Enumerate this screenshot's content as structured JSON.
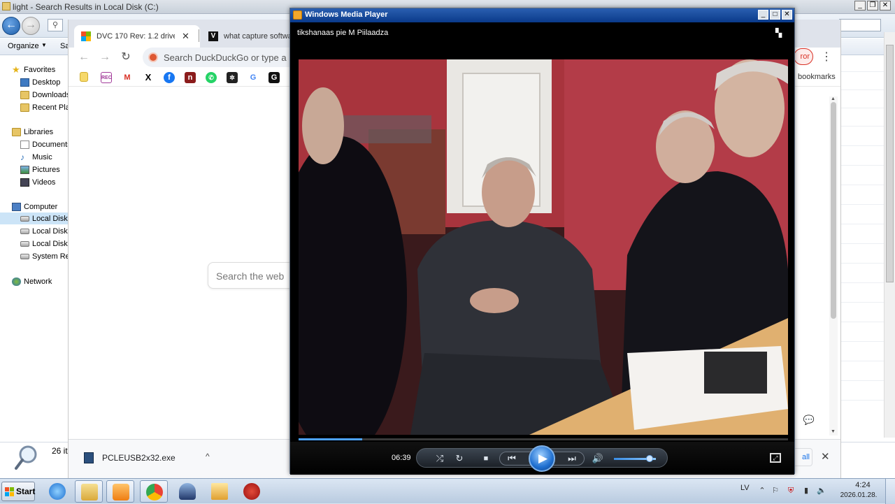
{
  "explorer": {
    "title": "light - Search Results in Local Disk (C:)",
    "toolbar": {
      "organize": "Organize",
      "sa": "Sa"
    },
    "sidebar": [
      {
        "label": "Favorites",
        "icon": "star-icon"
      },
      {
        "label": "Desktop",
        "icon": "desktop-icon"
      },
      {
        "label": "Downloads",
        "icon": "downloads-folder-icon"
      },
      {
        "label": "Recent Plac",
        "icon": "recent-places-icon"
      },
      {
        "label": "Libraries",
        "icon": "libraries-icon"
      },
      {
        "label": "Documents",
        "icon": "documents-icon"
      },
      {
        "label": "Music",
        "icon": "music-icon"
      },
      {
        "label": "Pictures",
        "icon": "pictures-icon"
      },
      {
        "label": "Videos",
        "icon": "videos-icon"
      },
      {
        "label": "Computer",
        "icon": "computer-icon"
      },
      {
        "label": "Local Disk (",
        "icon": "disk-icon",
        "selected": true
      },
      {
        "label": "Local Disk (",
        "icon": "disk-icon"
      },
      {
        "label": "Local Disk (",
        "icon": "disk-icon"
      },
      {
        "label": "System Res",
        "icon": "disk-icon"
      },
      {
        "label": "Network",
        "icon": "network-icon"
      }
    ],
    "status_items": "26 it"
  },
  "browser": {
    "tabs": [
      {
        "label": "DVC 170 Rev: 1.2 drivers",
        "close": "✕",
        "active": true
      },
      {
        "label": "what capture softwa",
        "active": false
      }
    ],
    "omnibox_placeholder": "Search DuckDuckGo or type a U",
    "error_pill": "ror",
    "menu": "⋮",
    "all_bookmarks": "bookmarks",
    "web_search_placeholder": "Search the web",
    "download": {
      "filename": "PCLEUSB2x32.exe",
      "caret": "^",
      "show_all": "all",
      "close": "✕"
    }
  },
  "wmp": {
    "title": "Windows Media Player",
    "now_playing": "tikshanaas pie M Piilaadza",
    "time": "06:39",
    "seek_progress": 0.13,
    "volume": 0.85
  },
  "taskbar": {
    "start": "Start",
    "language": "LV",
    "time": "4:24",
    "date": "2026.01.28."
  },
  "colors": {
    "wmp_title_bar": "#0a3a8a",
    "play_button": "#1f6fd0",
    "accent_blue": "#4da3ff"
  }
}
